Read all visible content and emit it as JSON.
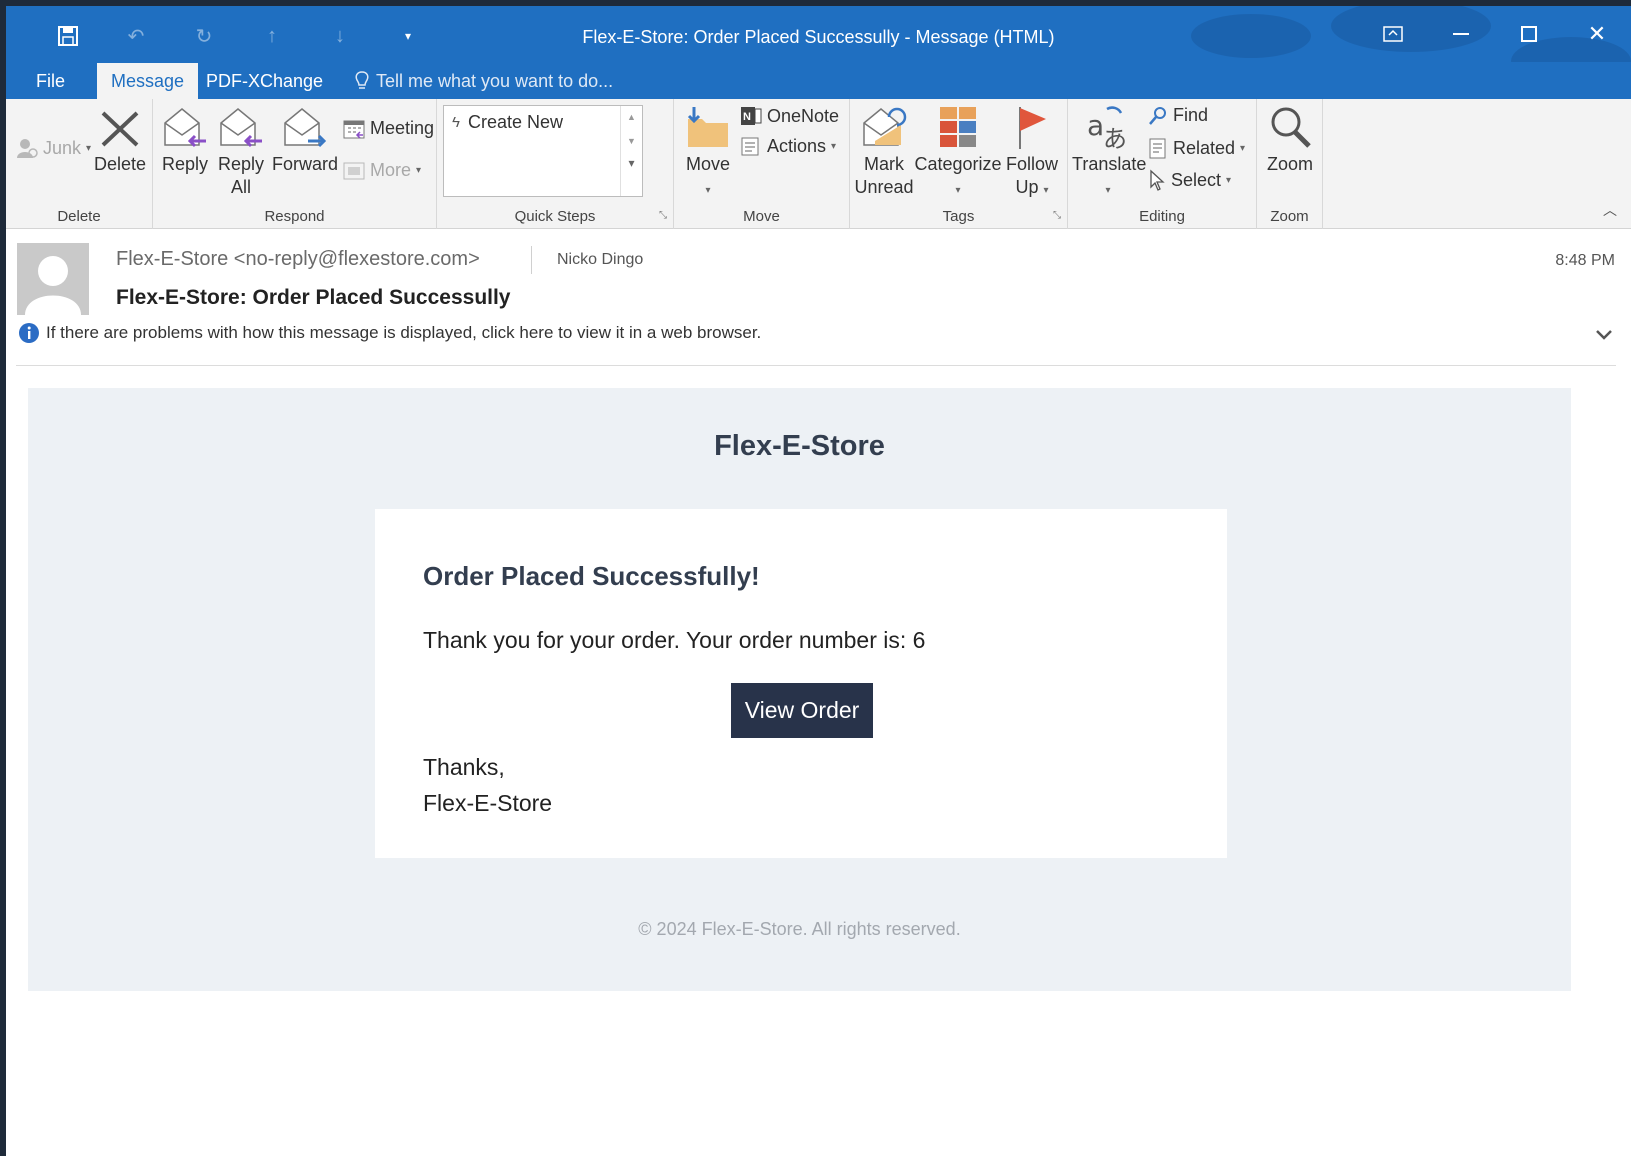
{
  "window": {
    "title": "Flex-E-Store: Order Placed Successully - Message (HTML)"
  },
  "tabs": [
    {
      "label": "File"
    },
    {
      "label": "Message"
    },
    {
      "label": "PDF-XChange"
    }
  ],
  "tell_me": "Tell me what you want to do...",
  "ribbon": {
    "delete_group": {
      "label": "Delete",
      "junk": "Junk",
      "delete": "Delete"
    },
    "respond_group": {
      "label": "Respond",
      "reply": "Reply",
      "reply_all_1": "Reply",
      "reply_all_2": "All",
      "forward": "Forward",
      "meeting": "Meeting",
      "more": "More"
    },
    "quicksteps_group": {
      "label": "Quick Steps",
      "create_new": "Create New"
    },
    "move_group": {
      "label": "Move",
      "move": "Move",
      "onenote": "OneNote",
      "actions": "Actions"
    },
    "tags_group": {
      "label": "Tags",
      "mark_unread_1": "Mark",
      "mark_unread_2": "Unread",
      "categorize": "Categorize",
      "follow_up_1": "Follow",
      "follow_up_2": "Up"
    },
    "editing_group": {
      "label": "Editing",
      "translate": "Translate",
      "find": "Find",
      "related": "Related",
      "select": "Select"
    },
    "zoom_group": {
      "label": "Zoom",
      "zoom": "Zoom"
    }
  },
  "header": {
    "from": "Flex-E-Store <no-reply@flexestore.com>",
    "to": "Nicko Dingo",
    "time": "8:48 PM",
    "subject": "Flex-E-Store: Order Placed Successully",
    "info": "If there are problems with how this message is displayed, click here to view it in a web browser."
  },
  "email": {
    "brand": "Flex-E-Store",
    "heading": "Order Placed Successfully!",
    "message": "Thank you for your order. Your order number is: 6",
    "button": "View Order",
    "thanks": "Thanks,",
    "signature": "Flex-E-Store",
    "copyright": "© 2024 Flex-E-Store. All rights reserved."
  },
  "colors": {
    "accent": "#1f6fc1",
    "button_bg": "#28334a",
    "mail_bg": "#edf1f5"
  }
}
